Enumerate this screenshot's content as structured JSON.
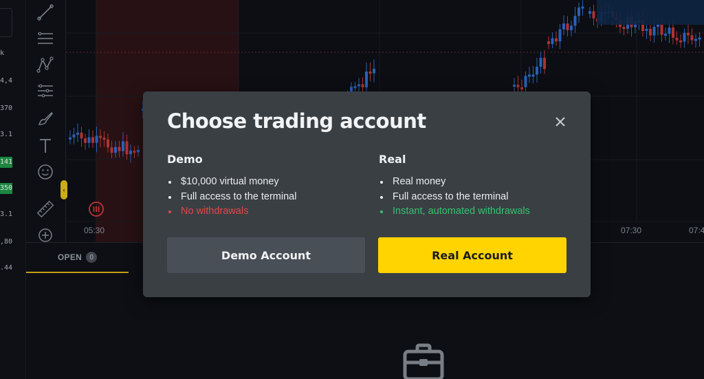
{
  "price_column": [
    "k",
    "4,4",
    "370",
    "3.1",
    "141",
    "350",
    "3.1",
    ",80",
    ".44"
  ],
  "chart": {
    "time_labels": [
      "05:30",
      "07:30",
      "07:4"
    ],
    "colors": {
      "up": "#2f6fd1",
      "down": "#c63a3a",
      "highlight": "#3a1518",
      "grid": "#1a1f27"
    }
  },
  "bottom": {
    "tab_label": "OPEN",
    "tab_count": "0"
  },
  "modal": {
    "title": "Choose trading account",
    "demo": {
      "heading": "Demo",
      "features": [
        "$10,000 virtual money",
        "Full access to the terminal",
        "No withdrawals"
      ],
      "button": "Demo Account"
    },
    "real": {
      "heading": "Real",
      "features": [
        "Real money",
        "Full access to the terminal",
        "Instant, automated withdrawals"
      ],
      "button": "Real Account"
    },
    "colors": {
      "accent": "#ffd400",
      "negative": "#e24848",
      "positive": "#37c26e"
    }
  },
  "icons": [
    "trend-line-icon",
    "horizontal-lines-icon",
    "pattern-icon",
    "fib-icon",
    "brush-icon",
    "text-icon",
    "emoji-icon",
    "ruler-icon",
    "zoom-in-icon",
    "close-icon",
    "briefcase-icon",
    "pause-icon"
  ]
}
